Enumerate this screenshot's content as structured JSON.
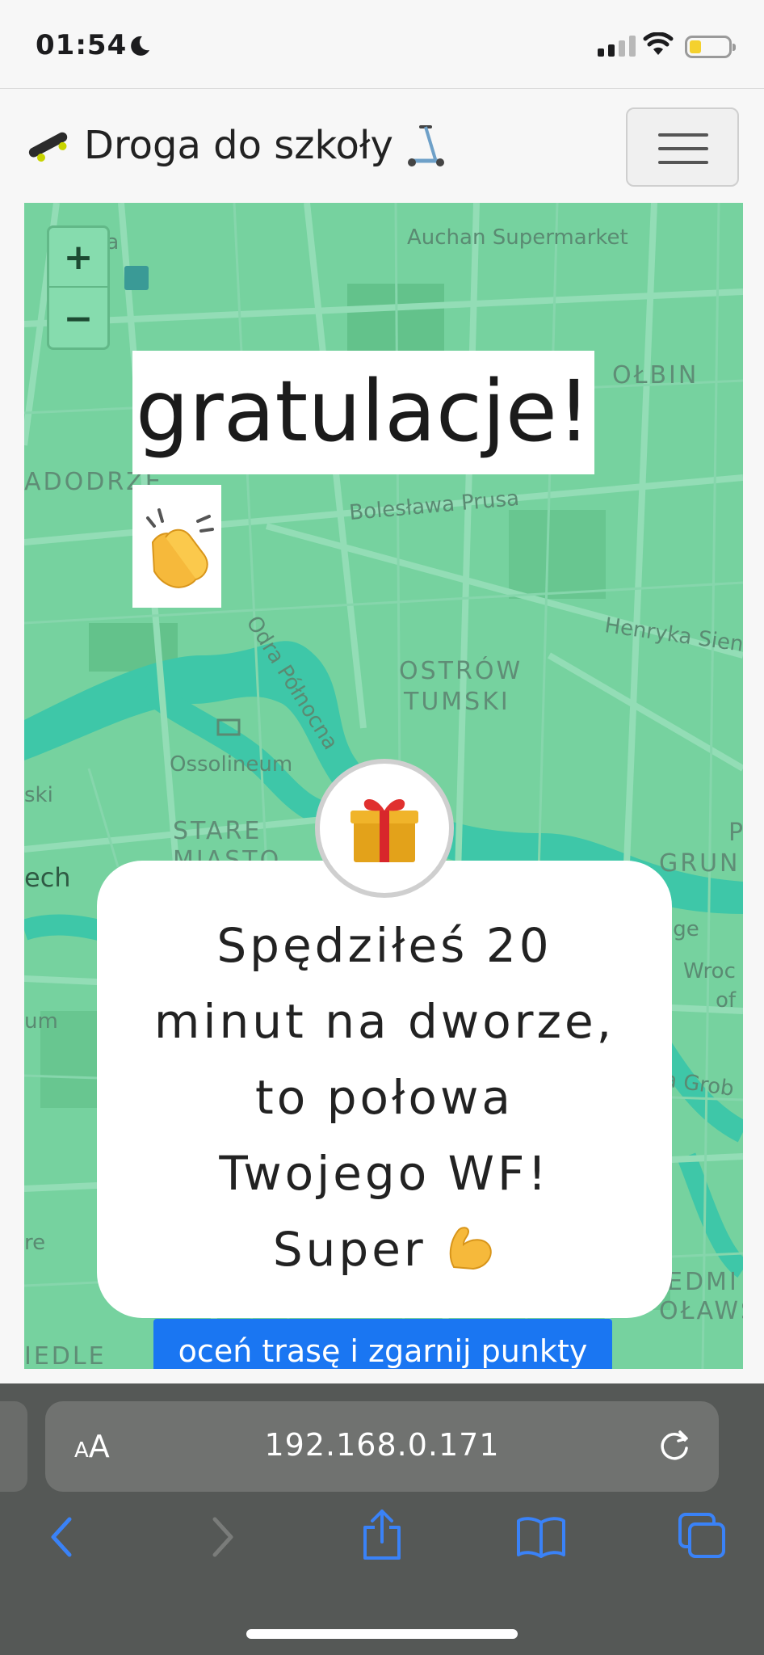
{
  "status_bar": {
    "time": "01:54",
    "moon_icon": "moon-icon",
    "signal_icon": "cellular-signal-icon",
    "wifi_icon": "wifi-icon",
    "battery_icon": "battery-icon",
    "battery_color": "#f4d12e"
  },
  "navbar": {
    "brand_text": "Droga do szkoły",
    "brand_left_icon": "skateboard-icon",
    "brand_right_icon": "scooter-icon",
    "menu_icon": "hamburger-menu-icon"
  },
  "map": {
    "zoom_in_label": "+",
    "zoom_out_label": "−",
    "labels": {
      "owska": "owska",
      "auchan": "Auchan Supermarket",
      "olbin": "OŁBIN",
      "nadodrze": "ADODRZE",
      "boleslawa": "Bolesława Prusa",
      "odra": "Odra Północna",
      "henryka": "Henryka Sien",
      "ostrow1": "OSTRÓW",
      "ostrow2": "TUMSKI",
      "ossolineum": "Ossolineum",
      "ski": "ski",
      "stare": "STARE",
      "miasto": "MIASTO",
      "ech": "ech",
      "p": "P",
      "grun": "GRUN",
      "ige": "lge",
      "wroc": "Wroc",
      "of": "of",
      "um": "um",
      "grob": "a Grob",
      "re": "re",
      "edmi": "EDMI",
      "olaws": "OŁAWS",
      "iedle": "IEDLE"
    },
    "water_color": "#3ec7a8",
    "land_color": "#76d29f"
  },
  "overlay": {
    "title": "gratulacje!",
    "clap_icon": "clapping-hands-icon",
    "gift_icon": "gift-icon",
    "message_lines": [
      "Spędziłeś 20",
      "minut na dworze,",
      "to połowa",
      "Twojego WF!",
      "Super"
    ],
    "message_end_icon": "flexed-biceps-icon",
    "button_label": "oceń trasę i zgarnij punkty",
    "button_color": "#1a76f2"
  },
  "browser": {
    "text_size_small": "A",
    "text_size_big": "A",
    "url": "192.168.0.171",
    "reload_icon": "reload-icon",
    "back_icon": "back-chevron-icon",
    "forward_icon": "forward-chevron-icon",
    "share_icon": "share-icon",
    "bookmarks_icon": "book-icon",
    "tabs_icon": "tabs-icon",
    "accent_color": "#3a82f7"
  }
}
